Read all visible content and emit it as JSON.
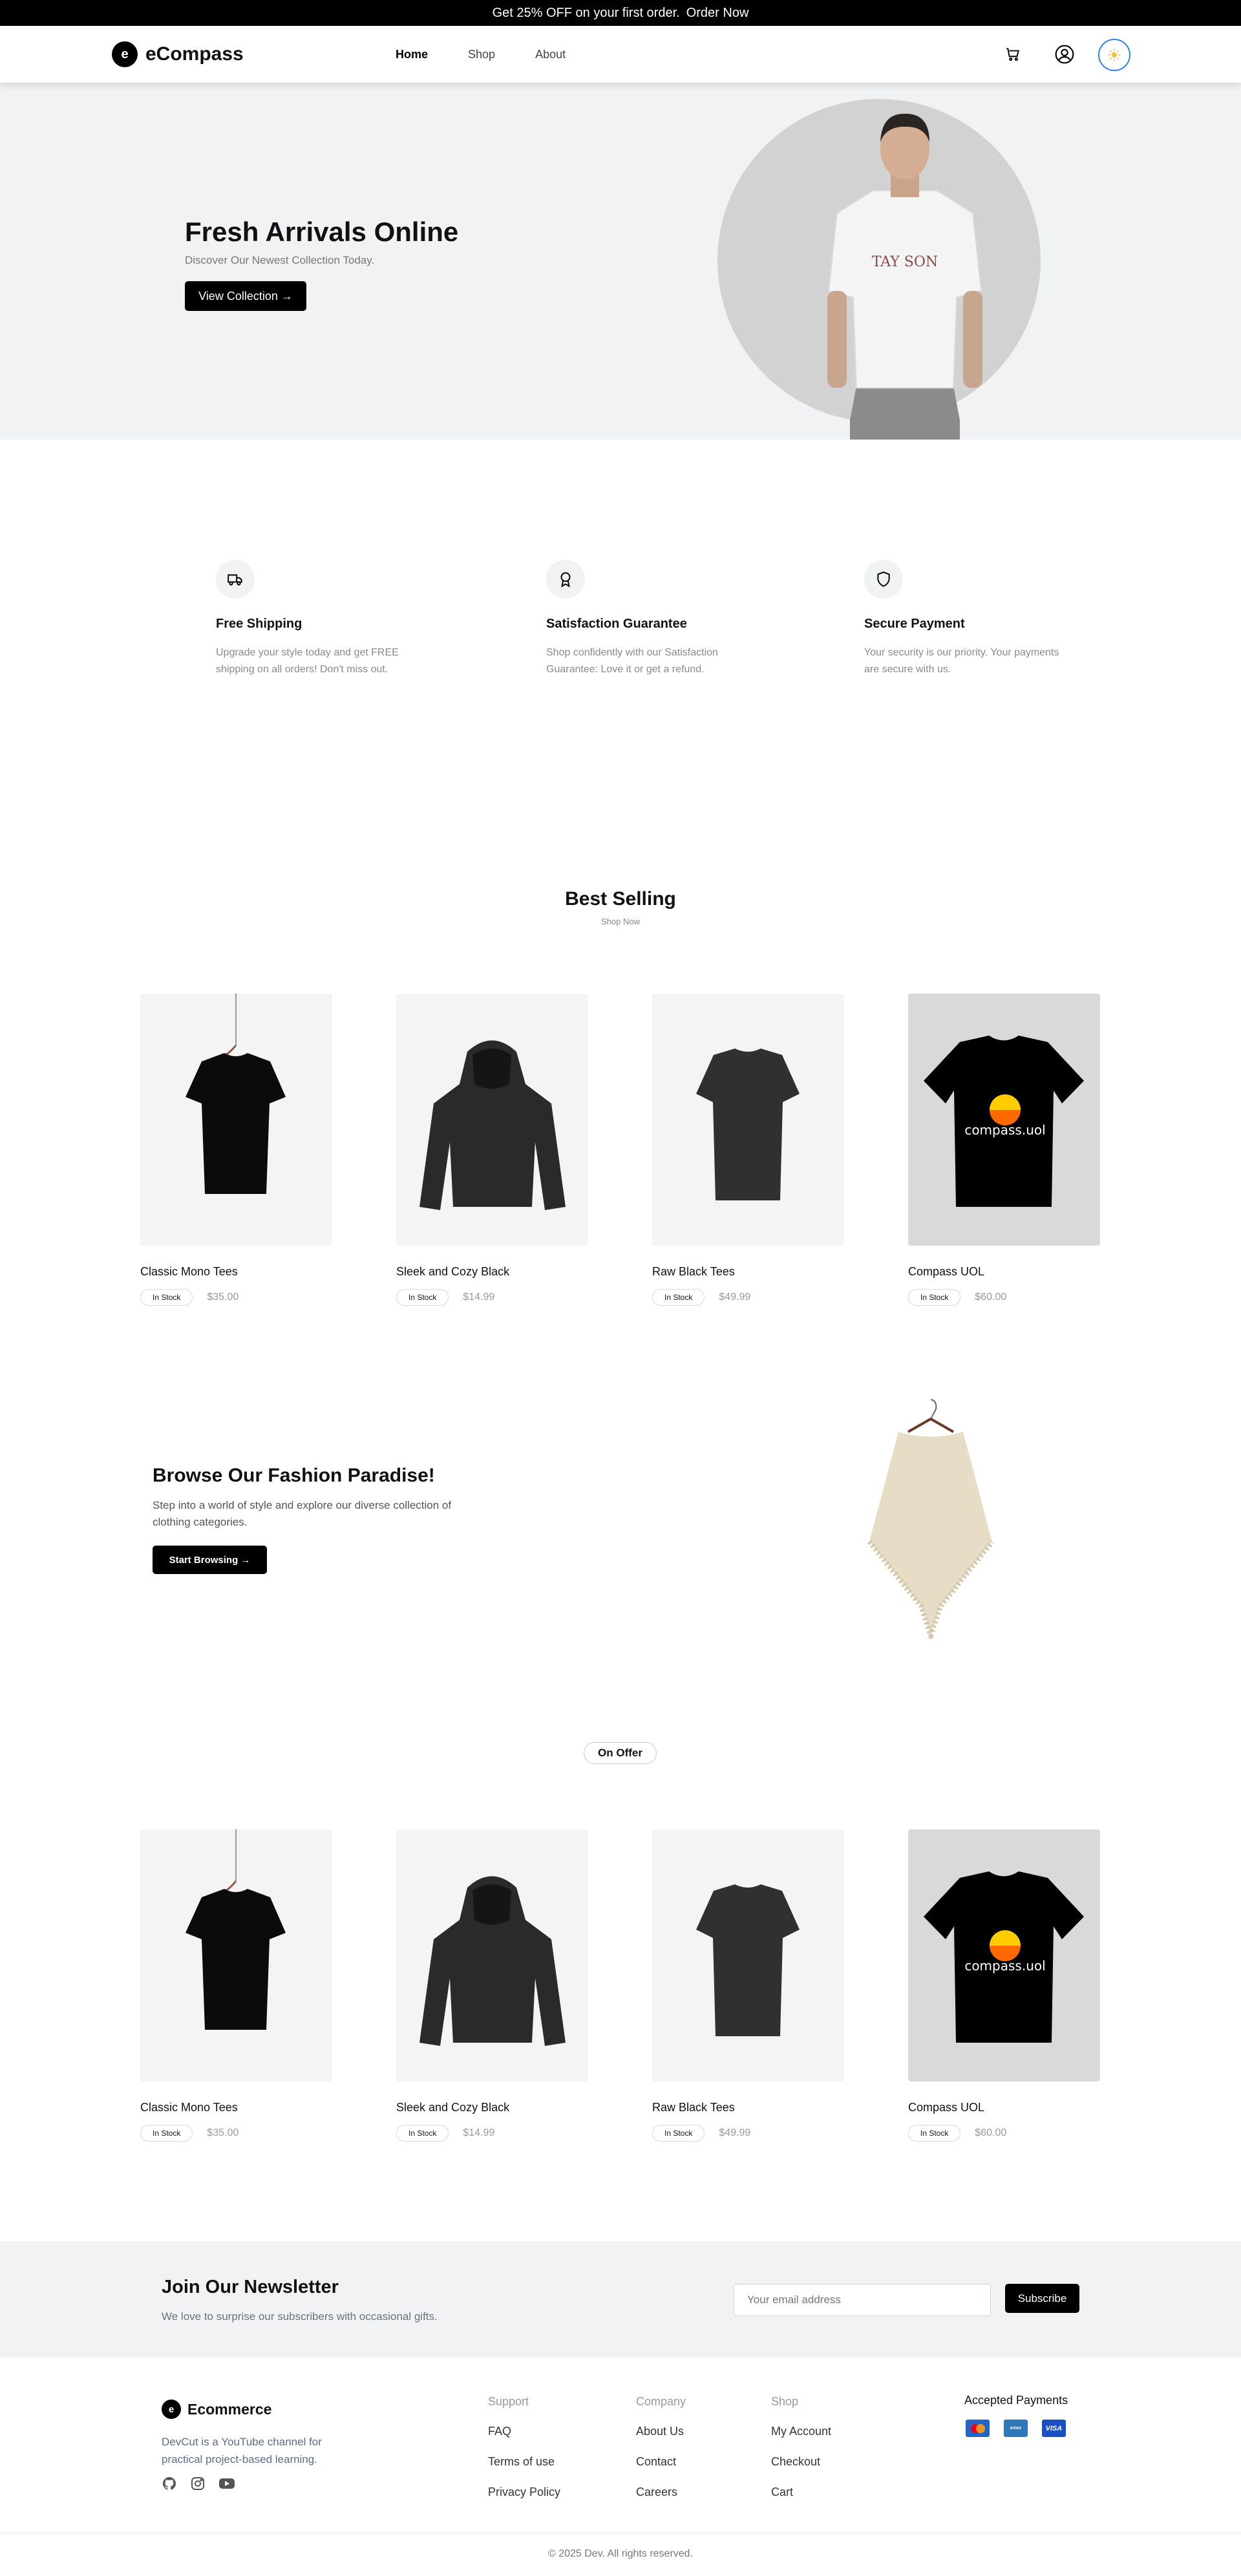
{
  "promo": {
    "text": "Get 25% OFF on your first order.",
    "link": "Order Now"
  },
  "header": {
    "logo_text": "eCompass",
    "nav": [
      "Home",
      "Shop",
      "About"
    ]
  },
  "hero": {
    "title": "Fresh Arrivals Online",
    "subtitle": "Discover Our Newest Collection Today.",
    "button": "View Collection →",
    "shirt_print": "TAY SON"
  },
  "features": [
    {
      "title": "Free Shipping",
      "desc": "Upgrade your style today and get FREE shipping on all orders! Don't miss out.",
      "icon": "truck-icon"
    },
    {
      "title": "Satisfaction Guarantee",
      "desc": "Shop confidently with our Satisfaction Guarantee: Love it or get a refund.",
      "icon": "award-icon"
    },
    {
      "title": "Secure Payment",
      "desc": "Your security is our priority. Your payments are secure with us.",
      "icon": "shield-icon"
    }
  ],
  "best_selling": {
    "title": "Best Selling",
    "subtitle": "Shop Now"
  },
  "products": [
    {
      "name": "Classic Mono Tees",
      "stock": "In Stock",
      "price": "$35.00"
    },
    {
      "name": "Sleek and Cozy Black",
      "stock": "In Stock",
      "price": "$14.99"
    },
    {
      "name": "Raw Black Tees",
      "stock": "In Stock",
      "price": "$49.99"
    },
    {
      "name": "Compass UOL",
      "stock": "In Stock",
      "price": "$60.00",
      "print": "compass.uol"
    }
  ],
  "promo_banner": {
    "title": "Browse Our Fashion Paradise!",
    "desc": "Step into a world of style and explore our diverse collection of clothing categories.",
    "button": "Start Browsing →"
  },
  "on_offer": {
    "label": "On Offer"
  },
  "newsletter": {
    "title": "Join Our Newsletter",
    "desc": "We love to surprise our subscribers with occasional gifts.",
    "placeholder": "Your email address",
    "button": "Subscribe"
  },
  "footer": {
    "brand": "Ecommerce",
    "about": "DevCut is a YouTube channel for practical project-based learning.",
    "cols": [
      {
        "title": "Support",
        "links": [
          "FAQ",
          "Terms of use",
          "Privacy Policy"
        ]
      },
      {
        "title": "Company",
        "links": [
          "About Us",
          "Contact",
          "Careers"
        ]
      },
      {
        "title": "Shop",
        "links": [
          "My Account",
          "Checkout",
          "Cart"
        ]
      }
    ],
    "payments_title": "Accepted Payments",
    "payments": [
      "mastercard",
      "amex",
      "VISA"
    ],
    "copyright": "© 2025 Dev. All rights reserved."
  },
  "colors": {
    "accent": "#2f80ed",
    "hero_bg": "#f1f2f4",
    "dark": "#000000"
  }
}
